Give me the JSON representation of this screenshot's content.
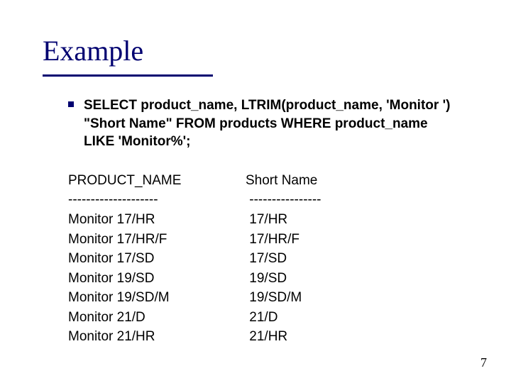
{
  "title": "Example",
  "bullet": "SELECT product_name, LTRIM(product_name, 'Monitor ') \"Short Name\" FROM products WHERE product_name LIKE 'Monitor%';",
  "table": {
    "header": {
      "c1": "PRODUCT_NAME",
      "c2": "Short Name"
    },
    "divider": {
      "c1": "--------------------",
      "c2": " ----------------"
    },
    "rows": [
      {
        "c1": "Monitor 17/HR",
        "c2": " 17/HR"
      },
      {
        "c1": "Monitor 17/HR/F",
        "c2": " 17/HR/F"
      },
      {
        "c1": "Monitor 17/SD",
        "c2": " 17/SD"
      },
      {
        "c1": "Monitor 19/SD",
        "c2": " 19/SD"
      },
      {
        "c1": "Monitor 19/SD/M",
        "c2": " 19/SD/M"
      },
      {
        "c1": "Monitor 21/D",
        "c2": " 21/D"
      },
      {
        "c1": "Monitor 21/HR",
        "c2": " 21/HR"
      }
    ]
  },
  "page_number": "7"
}
